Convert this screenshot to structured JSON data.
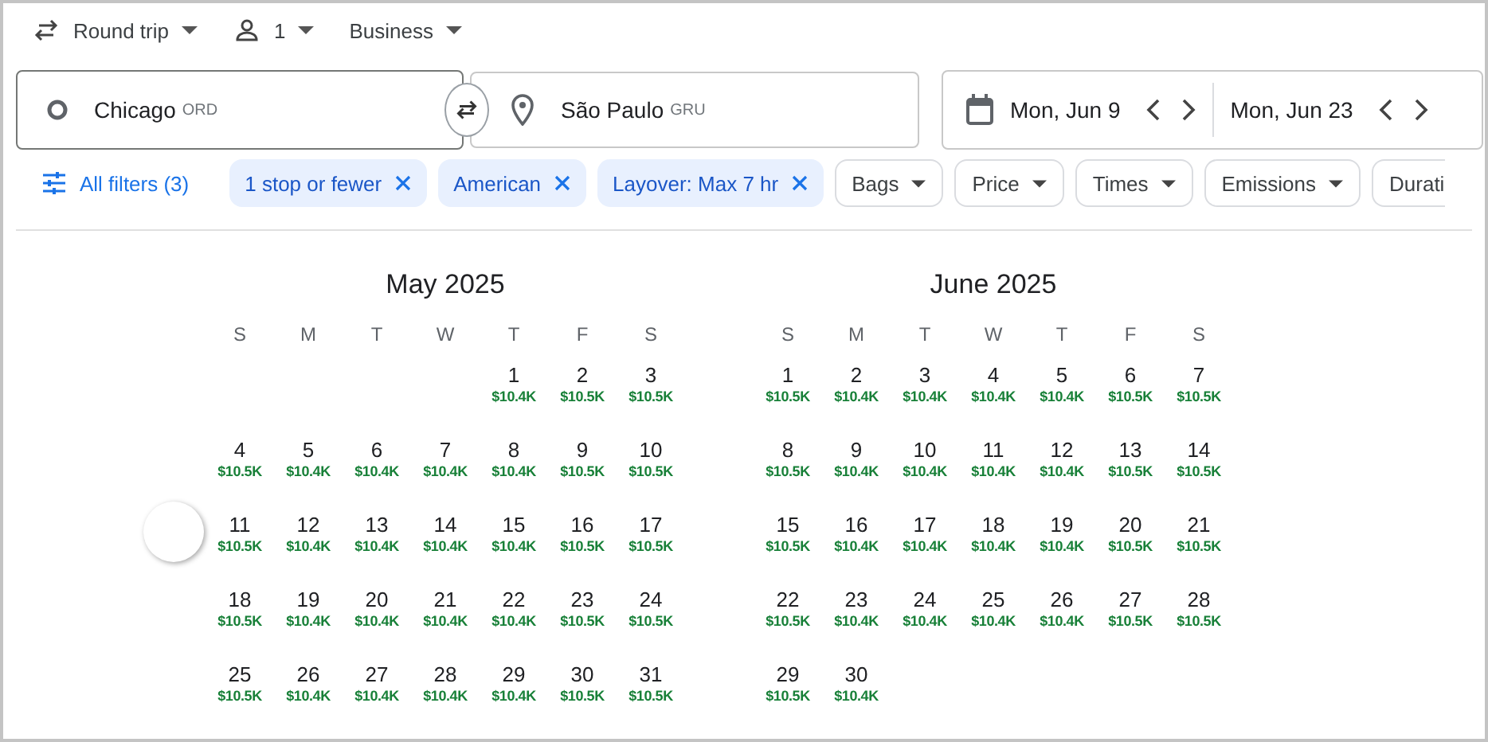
{
  "trip": {
    "type": "Round trip",
    "passengers": "1",
    "cabin": "Business"
  },
  "search": {
    "origin": {
      "city": "Chicago",
      "code": "ORD"
    },
    "destination": {
      "city": "São Paulo",
      "code": "GRU"
    },
    "depart": "Mon, Jun 9",
    "return": "Mon, Jun 23"
  },
  "filters": [
    {
      "kind": "all",
      "label": "All filters (3)"
    },
    {
      "kind": "active",
      "label": "1 stop or fewer"
    },
    {
      "kind": "active",
      "label": "American"
    },
    {
      "kind": "active",
      "label": "Layover: Max 7 hr"
    },
    {
      "kind": "menu",
      "label": "Bags"
    },
    {
      "kind": "menu",
      "label": "Price"
    },
    {
      "kind": "menu",
      "label": "Times"
    },
    {
      "kind": "menu",
      "label": "Emissions"
    },
    {
      "kind": "cut",
      "label": "Durati"
    }
  ],
  "months": [
    {
      "title": "May 2025",
      "weekdays": [
        "S",
        "M",
        "T",
        "W",
        "T",
        "F",
        "S"
      ],
      "weeks": [
        [
          {
            "day": "1",
            "price": "$10.4K"
          },
          {
            "day": "2",
            "price": "$10.5K"
          },
          {
            "day": "3",
            "price": "$10.5K"
          }
        ],
        [
          {
            "day": "4",
            "price": "$10.5K"
          },
          {
            "day": "5",
            "price": "$10.4K"
          },
          {
            "day": "6",
            "price": "$10.4K"
          },
          {
            "day": "7",
            "price": "$10.4K"
          },
          {
            "day": "8",
            "price": "$10.4K"
          },
          {
            "day": "9",
            "price": "$10.5K"
          },
          {
            "day": "10",
            "price": "$10.5K"
          }
        ],
        [
          {
            "day": "11",
            "price": "$10.5K"
          },
          {
            "day": "12",
            "price": "$10.4K"
          },
          {
            "day": "13",
            "price": "$10.4K"
          },
          {
            "day": "14",
            "price": "$10.4K"
          },
          {
            "day": "15",
            "price": "$10.4K"
          },
          {
            "day": "16",
            "price": "$10.5K"
          },
          {
            "day": "17",
            "price": "$10.5K"
          }
        ],
        [
          {
            "day": "18",
            "price": "$10.5K"
          },
          {
            "day": "19",
            "price": "$10.4K"
          },
          {
            "day": "20",
            "price": "$10.4K"
          },
          {
            "day": "21",
            "price": "$10.4K"
          },
          {
            "day": "22",
            "price": "$10.4K"
          },
          {
            "day": "23",
            "price": "$10.5K"
          },
          {
            "day": "24",
            "price": "$10.5K"
          }
        ],
        [
          {
            "day": "25",
            "price": "$10.5K"
          },
          {
            "day": "26",
            "price": "$10.4K"
          },
          {
            "day": "27",
            "price": "$10.4K"
          },
          {
            "day": "28",
            "price": "$10.4K"
          },
          {
            "day": "29",
            "price": "$10.4K"
          },
          {
            "day": "30",
            "price": "$10.5K"
          },
          {
            "day": "31",
            "price": "$10.5K"
          }
        ]
      ]
    },
    {
      "title": "June 2025",
      "weekdays": [
        "S",
        "M",
        "T",
        "W",
        "T",
        "F",
        "S"
      ],
      "weeks": [
        [
          {
            "day": "1",
            "price": "$10.5K"
          },
          {
            "day": "2",
            "price": "$10.4K"
          },
          {
            "day": "3",
            "price": "$10.4K"
          },
          {
            "day": "4",
            "price": "$10.4K"
          },
          {
            "day": "5",
            "price": "$10.4K"
          },
          {
            "day": "6",
            "price": "$10.5K"
          },
          {
            "day": "7",
            "price": "$10.5K"
          }
        ],
        [
          {
            "day": "8",
            "price": "$10.5K"
          },
          {
            "day": "9",
            "price": "$10.4K"
          },
          {
            "day": "10",
            "price": "$10.4K"
          },
          {
            "day": "11",
            "price": "$10.4K"
          },
          {
            "day": "12",
            "price": "$10.4K"
          },
          {
            "day": "13",
            "price": "$10.5K"
          },
          {
            "day": "14",
            "price": "$10.5K"
          }
        ],
        [
          {
            "day": "15",
            "price": "$10.5K"
          },
          {
            "day": "16",
            "price": "$10.4K"
          },
          {
            "day": "17",
            "price": "$10.4K"
          },
          {
            "day": "18",
            "price": "$10.4K"
          },
          {
            "day": "19",
            "price": "$10.4K"
          },
          {
            "day": "20",
            "price": "$10.5K"
          },
          {
            "day": "21",
            "price": "$10.5K"
          }
        ],
        [
          {
            "day": "22",
            "price": "$10.5K"
          },
          {
            "day": "23",
            "price": "$10.4K"
          },
          {
            "day": "24",
            "price": "$10.4K"
          },
          {
            "day": "25",
            "price": "$10.4K"
          },
          {
            "day": "26",
            "price": "$10.4K"
          },
          {
            "day": "27",
            "price": "$10.5K"
          },
          {
            "day": "28",
            "price": "$10.5K"
          }
        ],
        [
          {
            "day": "29",
            "price": "$10.5K"
          },
          {
            "day": "30",
            "price": "$10.4K"
          }
        ]
      ]
    }
  ]
}
